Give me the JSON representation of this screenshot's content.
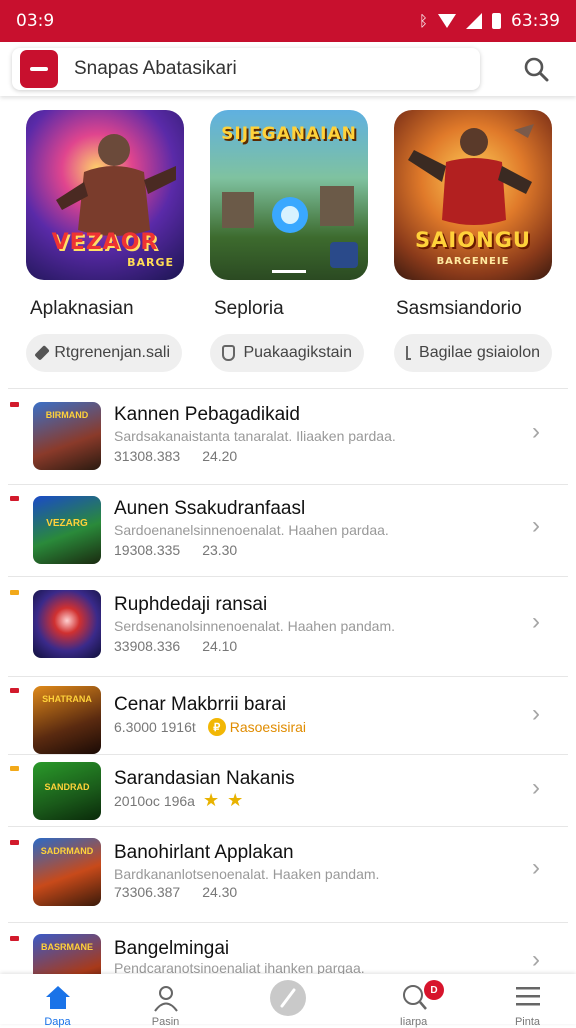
{
  "status_bar": {
    "time": "03:9",
    "right_time": "63:39"
  },
  "search": {
    "text": "Snapas Abatasikari"
  },
  "featured": [
    {
      "title": "Aplaknasian",
      "pill": "Rtgrenenjan.sali",
      "art_word": "VEZAOR",
      "art_sub": "BARGE",
      "pill_icon": "tag-icon"
    },
    {
      "title": "Seploria",
      "pill": "Puakaagikstain",
      "art_word": "SIJEGANAIAN",
      "art_sub": "",
      "pill_icon": "hand-icon"
    },
    {
      "title": "Sasmsiandorio",
      "pill": "Bagilae gsiaiolon",
      "art_word": "SAIONGU",
      "art_sub": "BARGENEIE",
      "pill_icon": "share-icon"
    }
  ],
  "list": [
    {
      "title": "Kannen Pebagadikaid",
      "desc": "Sardsakanaistanta tanaralat. Iliaaken pardaa.",
      "meta_a": "31308.383",
      "meta_b": "24.20",
      "mark_color": "#d21a2c",
      "thumb_word": "BIRMAND"
    },
    {
      "title": "Aunen Ssakudranfaasl",
      "desc": "Sardoenanelsinnenoenalat. Haahen pardaa.",
      "meta_a": "19308.335",
      "meta_b": "23.30",
      "mark_color": "#d21a2c",
      "thumb_word": "VEZARG"
    },
    {
      "title": "Ruphdedaji ransai",
      "desc": "Serdsenanolsinnenoenalat. Haahen pandam.",
      "meta_a": "33908.336",
      "meta_b": "24.10",
      "mark_color": "#f2a91a",
      "thumb_word": ""
    },
    {
      "title": "Cenar Makbrrii barai",
      "desc": "",
      "meta_a": "6.3000 1916t",
      "meta_b": "Rasoesisirai",
      "mark_color": "#d21a2c",
      "thumb_word": "SHATRANA"
    },
    {
      "title": "Sarandasian Nakanis",
      "desc": "",
      "meta_a": "2010oc 196a",
      "meta_b": "",
      "mark_color": "#f2a91a",
      "thumb_word": "SANDRAD"
    },
    {
      "title": "Banohirlant Applakan",
      "desc": "Bardkananlotsenoenalat. Haaken pandam.",
      "meta_a": "73306.387",
      "meta_b": "24.30",
      "mark_color": "#d21a2c",
      "thumb_word": "SADRMAND"
    },
    {
      "title": "Bangelmingai",
      "desc": "Pendcaranotsinoenaliat ihanken pargaa.",
      "meta_a": "",
      "meta_b": "",
      "mark_color": "#d21a2c",
      "thumb_word": "BASRMANE"
    }
  ],
  "nav": [
    {
      "label": "Dapa",
      "icon": "home-icon"
    },
    {
      "label": "Pasin",
      "icon": "person-icon"
    },
    {
      "label": "",
      "icon": "compass-icon"
    },
    {
      "label": "Iiarpa",
      "icon": "profile-icon",
      "badge": "D"
    },
    {
      "label": "Pinta",
      "icon": "menu-icon"
    }
  ],
  "colors": {
    "accent": "#c8102e",
    "active_nav": "#1a73e8"
  }
}
